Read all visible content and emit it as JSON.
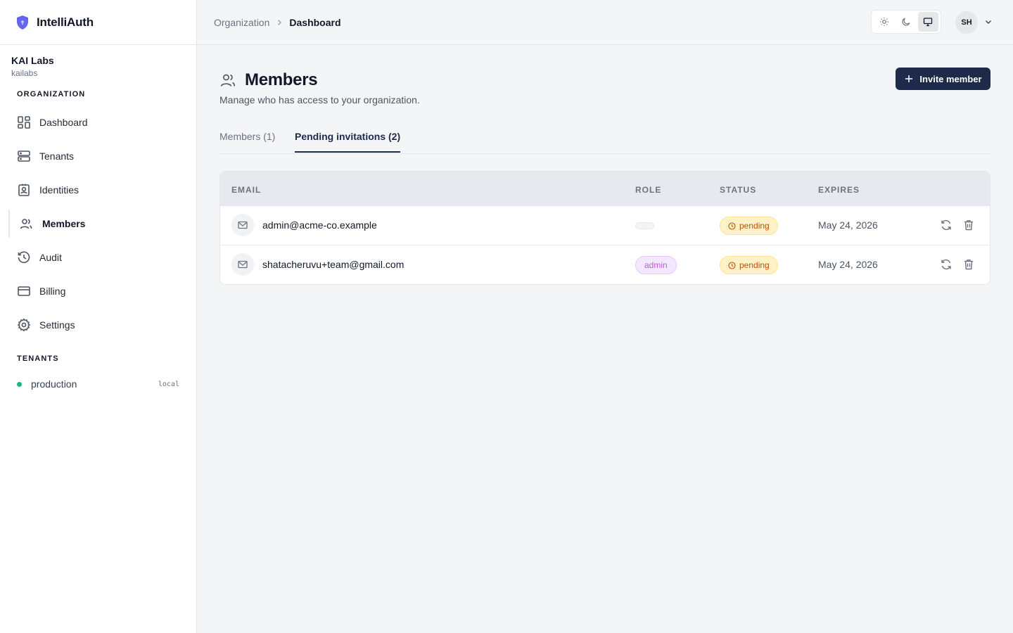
{
  "app": {
    "name": "IntelliAuth"
  },
  "org": {
    "name": "KAI Labs",
    "slug": "kailabs"
  },
  "sidebar": {
    "section_org": "ORGANIZATION",
    "items": [
      {
        "label": "Dashboard",
        "icon": "dashboard-icon"
      },
      {
        "label": "Tenants",
        "icon": "server-icon"
      },
      {
        "label": "Identities",
        "icon": "id-badge-icon"
      },
      {
        "label": "Members",
        "icon": "users-icon",
        "active": true
      },
      {
        "label": "Audit",
        "icon": "history-icon"
      },
      {
        "label": "Billing",
        "icon": "credit-card-icon"
      },
      {
        "label": "Settings",
        "icon": "gear-icon"
      }
    ],
    "section_tenants": "TENANTS",
    "tenants": [
      {
        "name": "production",
        "tag": "local",
        "status_color": "#10b981"
      }
    ]
  },
  "topbar": {
    "breadcrumb": [
      "Organization",
      "Dashboard"
    ],
    "theme_options": [
      "light",
      "dark",
      "system"
    ],
    "theme_selected": "system",
    "avatar_initials": "SH"
  },
  "page": {
    "title": "Members",
    "subtitle": "Manage who has access to your organization.",
    "invite_label": "Invite member",
    "tabs": [
      {
        "label": "Members (1)",
        "active": false
      },
      {
        "label": "Pending invitations (2)",
        "active": true
      }
    ]
  },
  "table": {
    "headers": [
      "EMAIL",
      "ROLE",
      "STATUS",
      "EXPIRES"
    ],
    "rows": [
      {
        "email": "admin@acme-co.example",
        "role": "",
        "status": "pending",
        "expires": "May 24, 2026"
      },
      {
        "email": "shatacheruvu+team@gmail.com",
        "role": "admin",
        "status": "pending",
        "expires": "May 24, 2026"
      }
    ]
  },
  "colors": {
    "primary": "#1e2a4a",
    "brand": "#6366f1",
    "status_pending_bg": "#fef3c7",
    "status_pending_text": "#b45309",
    "role_admin_bg": "#f3e8ff",
    "role_admin_text": "#c05ad8",
    "tenant_online": "#10b981"
  }
}
